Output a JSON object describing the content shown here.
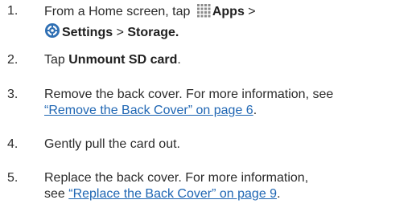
{
  "steps": [
    {
      "number": "1.",
      "line1_pre": "From a Home screen, tap ",
      "apps_icon": "apps-grid-icon",
      "apps_label": "Apps",
      "line1_post": " >",
      "settings_icon": "settings-gear-icon",
      "settings_label": "Settings",
      "sep": " > ",
      "storage_label": "Storage."
    },
    {
      "number": "2.",
      "pre": "Tap ",
      "bold": "Unmount SD card",
      "post": "."
    },
    {
      "number": "3.",
      "line1": "Remove the back cover. For more information, see",
      "link": "“Remove the Back Cover” on page 6",
      "post": "."
    },
    {
      "number": "4.",
      "text": "Gently pull the card out."
    },
    {
      "number": "5.",
      "line1": "Replace the back cover. For more information,",
      "pre2": "see ",
      "link": "“Replace the Back Cover” on page 9",
      "post": "."
    }
  ],
  "colors": {
    "text": "#2b2b2b",
    "link": "#1f66b3",
    "settings_icon": "#2f6fb3"
  }
}
